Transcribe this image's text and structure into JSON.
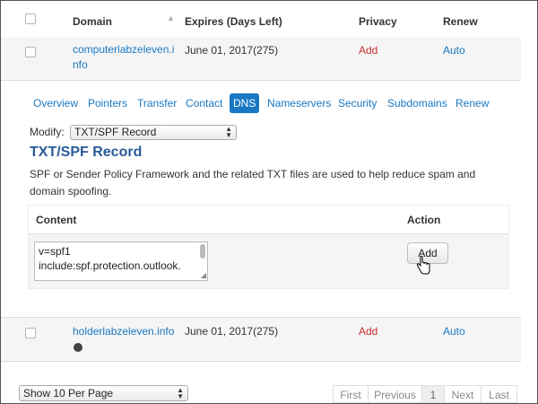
{
  "header": {
    "domain": "Domain",
    "expires": "Expires (Days Left)",
    "privacy": "Privacy",
    "renew": "Renew"
  },
  "row1": {
    "domain_line1": "computerlabzeleven.i",
    "domain_line2": "nfo",
    "expires": "June 01, 2017(275)",
    "privacy": "Add",
    "renew": "Auto"
  },
  "tabs": [
    "Overview",
    "Pointers",
    "Transfer",
    "Contact",
    "DNS",
    "Nameservers",
    "Security",
    "Subdomains",
    "Renew"
  ],
  "active_tab": "DNS",
  "modify": {
    "label": "Modify:",
    "value": "TXT/SPF Record"
  },
  "record": {
    "title": "TXT/SPF Record",
    "description": "SPF or Sender Policy Framework and the related TXT files are used to help reduce spam and domain spoofing.",
    "col_content": "Content",
    "col_action": "Action",
    "content_line1": "v=spf1",
    "content_line2": "include:spf.protection.outlook.",
    "add_button": "Add"
  },
  "row2": {
    "domain": "holderlabzeleven.info",
    "expires": "June 01, 2017(275)",
    "privacy": "Add",
    "renew": "Auto"
  },
  "per_page": "Show 10 Per Page",
  "pagination": {
    "first": "First",
    "previous": "Previous",
    "current": "1",
    "next": "Next",
    "last": "Last"
  },
  "colors": {
    "link": "#1a78c2",
    "privacy": "#c9302c",
    "title": "#2a5a9a"
  }
}
